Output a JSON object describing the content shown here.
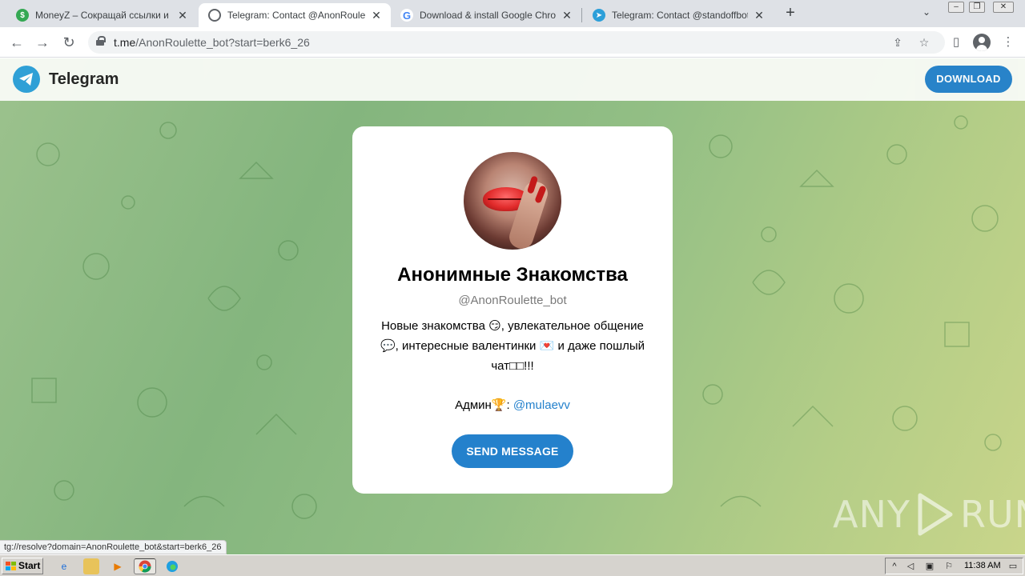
{
  "browser": {
    "tabs": [
      {
        "title": "MoneyZ – Сокращай ссылки и зарабатывай",
        "favicon": "moneyz-icon",
        "favicon_color": "#34a853",
        "active": false
      },
      {
        "title": "Telegram: Contact @AnonRoulette_bot",
        "favicon": "globe-icon",
        "favicon_color": "#5f6368",
        "active": true
      },
      {
        "title": "Download & install Google Chrome - Google Chrome Help",
        "favicon": "google-icon",
        "favicon_color": "#ffffff",
        "active": false
      },
      {
        "title": "Telegram: Contact @standoffbot",
        "favicon": "telegram-icon",
        "favicon_color": "#2c9fd9",
        "active": false
      }
    ],
    "url_host": "t.me",
    "url_rest": "/AnonRoulette_bot?start=berk6_26"
  },
  "telegram": {
    "brand": "Telegram",
    "download_label": "DOWNLOAD",
    "title": "Анонимные Знакомства",
    "username": "@AnonRoulette_bot",
    "description_line1": "Новые знакомства 😏, увлекательное общение",
    "description_line2": "💬, интересные валентинки 💌 и даже пошлый",
    "description_line3": "чат□□!!!",
    "admin_prefix": "Админ🏆: ",
    "admin_link": "@mulaevv",
    "send_label": "SEND MESSAGE"
  },
  "status_url": "tg://resolve?domain=AnonRoulette_bot&start=berk6_26",
  "watermark": {
    "left": "ANY",
    "right": "RUN"
  },
  "taskbar": {
    "start_label": "Start",
    "clock": "11:38 AM"
  },
  "colors": {
    "telegram_blue": "#2481cc",
    "logo_blue": "#2c9fd9",
    "link": "#2481cc"
  }
}
